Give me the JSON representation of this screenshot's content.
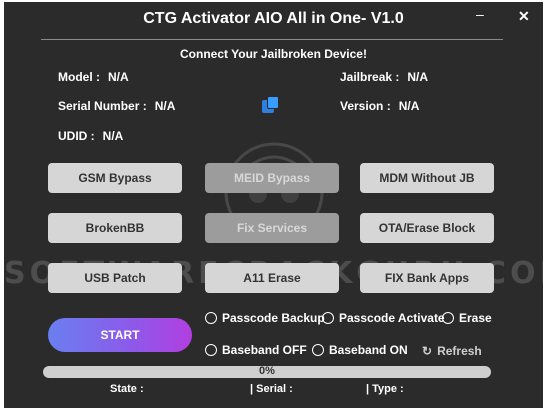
{
  "window": {
    "title": "CTG Activator AIO All in One- V1.0",
    "minimize_glyph": "–",
    "close_glyph": "✕"
  },
  "subtitle": "Connect Your Jailbroken Device!",
  "device": {
    "model_label": "Model :",
    "model_value": "N/A",
    "serial_label": "Serial Number :",
    "serial_value": "N/A",
    "udid_label": "UDID :",
    "udid_value": "N/A",
    "jailbreak_label": "Jailbreak :",
    "jailbreak_value": "N/A",
    "version_label": "Version :",
    "version_value": "N/A"
  },
  "buttons": {
    "gsm_bypass": "GSM Bypass",
    "meid_bypass": "MEID Bypass",
    "mdm_without_jb": "MDM Without JB",
    "brokenbb": "BrokenBB",
    "fix_services": "Fix Services",
    "ota_erase_block": "OTA/Erase Block",
    "usb_patch": "USB Patch",
    "a11_erase": "A11 Erase",
    "fix_bank_apps": "FIX Bank Apps",
    "start": "START"
  },
  "options": {
    "passcode_backup": "Passcode Backup",
    "passcode_activate": "Passcode Activate",
    "erase": "Erase",
    "baseband_off": "Baseband OFF",
    "baseband_on": "Baseband ON"
  },
  "refresh_label": "Refresh",
  "progress": {
    "value": 0,
    "label": "0%"
  },
  "status_bar": {
    "state": "State :",
    "serial": "| Serial :",
    "type": "| Type :"
  },
  "watermark": "SOFTWARECRACKGURU.COM",
  "colors": {
    "background": "#2b2b2b",
    "button": "#d6d6d6",
    "button_disabled": "#9c9c9c",
    "accent_blue": "#3b9cff",
    "start_gradient_start": "#6a7ff0",
    "start_gradient_end": "#b23fe0"
  },
  "icons": {
    "copy": "copy-icon",
    "refresh": "refresh-icon",
    "skull": "skull-logo-icon"
  }
}
